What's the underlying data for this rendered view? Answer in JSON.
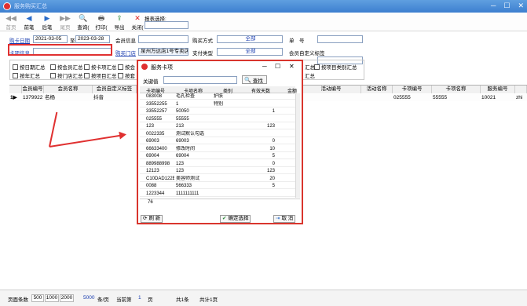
{
  "window": {
    "title": "服务购买汇总",
    "minimize": "─",
    "maximize": "☐",
    "close": "✕"
  },
  "toolbar": [
    {
      "label": "首页",
      "icon": "◀◀",
      "disabled": true
    },
    {
      "label": "前笔",
      "icon": "◀",
      "disabled": false
    },
    {
      "label": "后笔",
      "icon": "▶",
      "disabled": false
    },
    {
      "label": "尾页",
      "icon": "▶▶",
      "disabled": true
    },
    {
      "label": "查询(",
      "icon": "🔍",
      "disabled": false
    },
    {
      "label": "打印(",
      "icon": "🖶",
      "disabled": false
    },
    {
      "label": "导出",
      "icon": "⇪",
      "disabled": false
    },
    {
      "label": "关闭(",
      "icon": "✕",
      "disabled": false
    }
  ],
  "report_select": {
    "label": "报表选择:",
    "value": ""
  },
  "filters": {
    "buy_date_label": "购卡日期",
    "date_from": "2021-03-05",
    "to_label": "至",
    "date_to": "2023-03-28",
    "member_info_label": "会员信息",
    "member_info_value": "",
    "buy_method_label": "购买方式",
    "buy_method_value": "全部",
    "single_label": "单　号",
    "single_value": "",
    "card_info_label": "卡项信息",
    "card_info_value": "",
    "buy_store_label": "购买门店",
    "buy_store_value": "泉州万达店1号专卖店",
    "pay_type_label": "支付类型",
    "pay_type_value": "全部",
    "member_custom_label": "会员自定义标签",
    "member_custom_value": ""
  },
  "checkboxes": [
    {
      "label": "按日期汇总"
    },
    {
      "label": "按年汇总"
    },
    {
      "label": "按会员汇总"
    },
    {
      "label": "按门店汇总"
    },
    {
      "label": "按卡项汇总"
    },
    {
      "label": "按项目汇总"
    },
    {
      "label": "按会"
    },
    {
      "label": "按套"
    },
    {
      "label": "按项目类别汇总"
    },
    {
      "label": "汇总"
    },
    {
      "label": "汇总"
    }
  ],
  "grid": {
    "columns": [
      "会员编号",
      "会员名称",
      "会员自定义标签",
      "",
      "活动编号",
      "活动名称",
      "卡项编号",
      "卡项名称",
      "服务编号",
      ""
    ],
    "row": {
      "marker": "1▶",
      "member_no": "1379922",
      "member_name": "名杨",
      "tag": "抖音",
      "card_no": "025555",
      "card_name": "55555",
      "service_no": "10021",
      "extra": "zhi"
    }
  },
  "status": {
    "page_rows_label": "页面条数",
    "sizes": [
      "500",
      "1000",
      "2000"
    ],
    "current_size": "5000",
    "per_page": "条/页",
    "current_label": "当前第",
    "current_page": "1",
    "page_unit": "页",
    "total": "共1条",
    "total_pages": "共计1页"
  },
  "dialog": {
    "title": "服务卡项",
    "keyword_label": "关键值",
    "keyword_value": "",
    "search_label": "查找",
    "columns": [
      "卡项编号",
      "卡项名称",
      "类别",
      "有效天数",
      "金额"
    ],
    "rows": [
      [
        "083008",
        "毛孔检查",
        "护肤",
        "",
        ""
      ],
      [
        "33552255",
        "1",
        "特别",
        "",
        ""
      ],
      [
        "33552257",
        "50050",
        "",
        "1",
        ""
      ],
      [
        "025555",
        "55555",
        "",
        "",
        ""
      ],
      [
        "123",
        "213",
        "",
        "123",
        ""
      ],
      [
        "0022335",
        "测试默认勾选",
        "",
        "",
        ""
      ],
      [
        "69003",
        "69003",
        "",
        "0",
        ""
      ],
      [
        "66633400",
        "修改时间",
        "",
        "10",
        ""
      ],
      [
        "69004",
        "69004",
        "",
        "5",
        ""
      ],
      [
        "889988998",
        "123",
        "",
        "0",
        ""
      ],
      [
        "12123",
        "123",
        "",
        "123",
        ""
      ],
      [
        "C10DAD122E",
        "美容师测试",
        "",
        "20",
        ""
      ],
      [
        "0088",
        "566333",
        "",
        "5",
        ""
      ],
      [
        "1223344",
        "1111111111",
        "",
        "",
        ""
      ]
    ],
    "count": "76",
    "refresh_label": "刷 新",
    "confirm_label": "确定选择",
    "cancel_label": "取 消"
  }
}
